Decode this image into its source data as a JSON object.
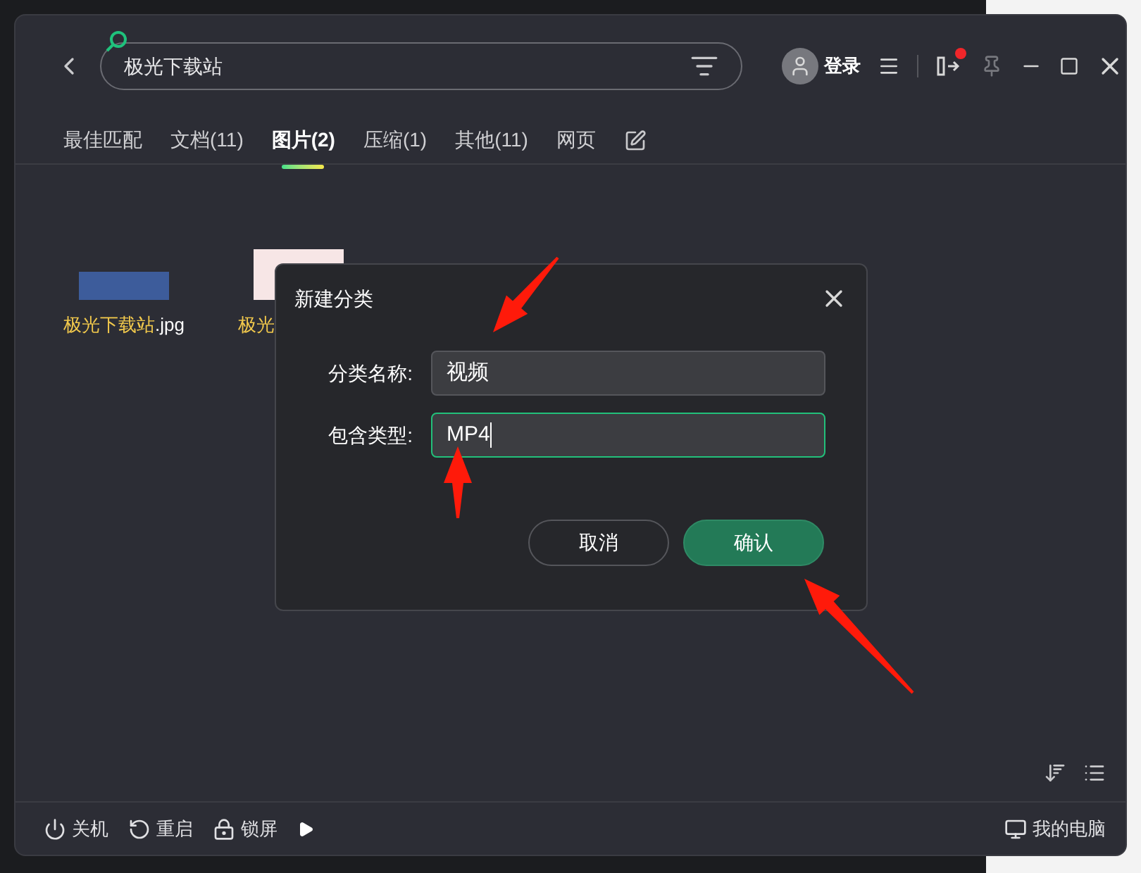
{
  "search": {
    "value": "极光下载站"
  },
  "account": {
    "label": "登录"
  },
  "toolbar": {
    "notification_dot": true
  },
  "tabs": [
    {
      "label": "最佳匹配",
      "selected": false
    },
    {
      "label": "文档(11)",
      "selected": false
    },
    {
      "label": "图片(2)",
      "selected": true
    },
    {
      "label": "压缩(1)",
      "selected": false
    },
    {
      "label": "其他(11)",
      "selected": false
    },
    {
      "label": "网页",
      "selected": false
    }
  ],
  "files": [
    {
      "kind": "banner",
      "match": "极光下载站",
      "rest": ".jpg"
    },
    {
      "kind": "screenshot",
      "match": "极光"
    }
  ],
  "dialog": {
    "title": "新建分类",
    "fields": [
      {
        "label": "分类名称:",
        "value": "视频",
        "focused": false
      },
      {
        "label": "包含类型:",
        "value": "MP4",
        "focused": true
      }
    ],
    "buttons": [
      {
        "label": "取消",
        "kind": "secondary"
      },
      {
        "label": "确认",
        "kind": "primary"
      }
    ]
  },
  "bottom_bar": {
    "actions": [
      {
        "kind": "power",
        "label": "关机"
      },
      {
        "kind": "restart",
        "label": "重启"
      },
      {
        "kind": "lock",
        "label": "锁屏"
      }
    ],
    "computer": "我的电脑"
  }
}
